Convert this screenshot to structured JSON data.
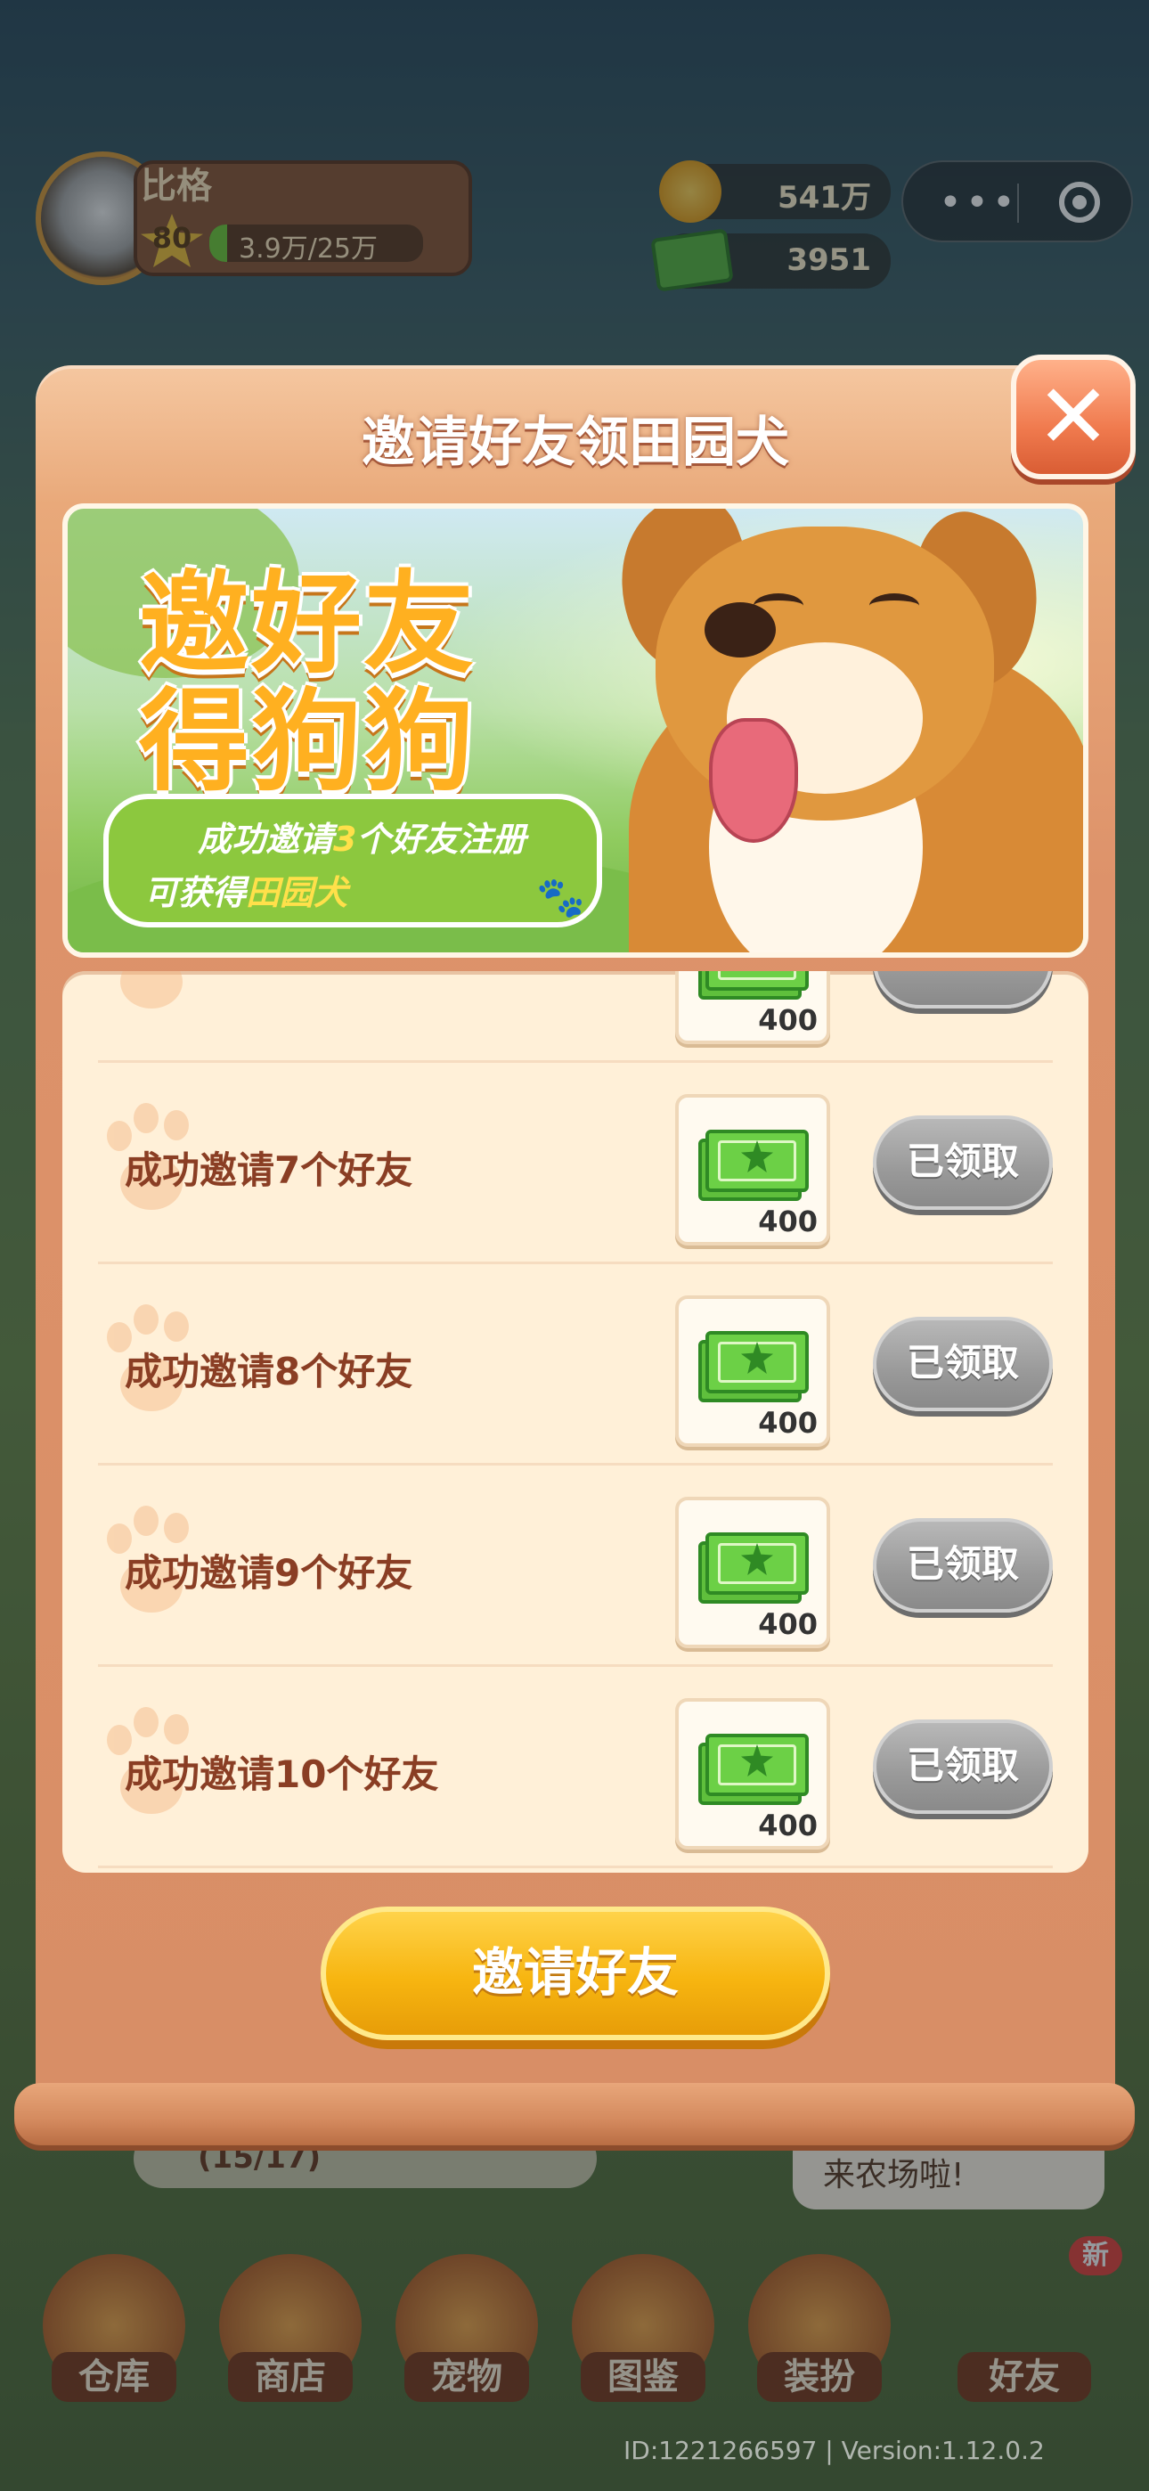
{
  "hud": {
    "player_name": "比格",
    "level": "80",
    "xp": "3.9万/25万",
    "coins": "541万",
    "cash": "3951"
  },
  "modal": {
    "title": "邀请好友领田园犬",
    "close_icon": "close-icon",
    "banner": {
      "headline_line1": "邀好友",
      "headline_line2": "得狗狗",
      "sub_line1_prefix": "成功邀请",
      "sub_line1_number": "3",
      "sub_line1_suffix": "个好友注册",
      "sub_line2_prefix": "可获得",
      "sub_line2_highlight": "田园犬"
    },
    "rewards": [
      {
        "label": "",
        "quantity": "400",
        "status": ""
      },
      {
        "label": "成功邀请7个好友",
        "quantity": "400",
        "status": "已领取"
      },
      {
        "label": "成功邀请8个好友",
        "quantity": "400",
        "status": "已领取"
      },
      {
        "label": "成功邀请9个好友",
        "quantity": "400",
        "status": "已领取"
      },
      {
        "label": "成功邀请10个好友",
        "quantity": "400",
        "status": "已领取"
      }
    ],
    "invite_button": "邀请好友"
  },
  "background": {
    "quest_progress": "(15/17)",
    "speech_text": "来农场啦!",
    "nav": [
      "仓库",
      "商店",
      "宠物",
      "图鉴",
      "装扮"
    ],
    "friends_label": "好友",
    "new_badge": "新",
    "footer": "ID:1221266597  |  Version:1.12.0.2"
  },
  "colors": {
    "modal_bg": "#dd926a",
    "list_bg": "#fff0d8",
    "invite_button": "#f7b510",
    "claimed_button": "#999999",
    "label_text": "#8a3e24"
  }
}
